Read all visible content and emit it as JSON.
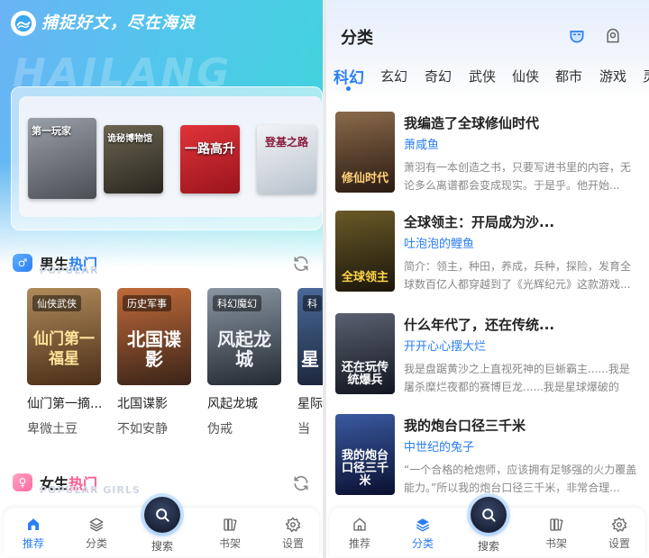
{
  "left": {
    "header": {
      "slogan": "捕捉好文，尽在海浪",
      "watermark": "HAILANG"
    },
    "banner": {
      "covers": [
        {
          "title": "第一玩家",
          "bg": "#5b5e63"
        },
        {
          "title": "诡秘博物馆",
          "bg": "#3d3a32"
        },
        {
          "title": "一路高升",
          "bg": "#c9202a"
        },
        {
          "title": "登基之路",
          "bg": "#d8dde4"
        }
      ]
    },
    "male_section": {
      "title_prefix": "男生",
      "title_highlight": "热门",
      "subtitle": "POPULAR",
      "books": [
        {
          "tag": "仙侠武侠",
          "cover_text": "仙门第一福星",
          "title": "仙门第一摘...",
          "author": "卑微土豆",
          "bg": "#6b4a2a",
          "fg": "#ffe39a"
        },
        {
          "tag": "历史军事",
          "cover_text": "北国谍影",
          "title": "北国谍影",
          "author": "不如安静",
          "bg": "#6a3e2a",
          "fg": "#ffffff"
        },
        {
          "tag": "科幻魔幻",
          "cover_text": "风起龙城",
          "title": "风起龙城",
          "author": "伪戒",
          "bg": "#3a4450",
          "fg": "#e6ecf2"
        },
        {
          "tag": "科",
          "cover_text": "星",
          "title": "星际...",
          "author": "当",
          "bg": "#2a3b58",
          "fg": "#ffffff"
        }
      ]
    },
    "female_section": {
      "title_prefix": "女生",
      "title_highlight": "热门",
      "subtitle": "POPULAR GIRLS"
    }
  },
  "right": {
    "title": "分类",
    "categories": [
      "科幻",
      "玄幻",
      "奇幻",
      "武侠",
      "仙侠",
      "都市",
      "游戏",
      "灵"
    ],
    "active_category": "科幻",
    "books": [
      {
        "name": "我编造了全球修仙时代",
        "author": "萧咸鱼",
        "desc": "萧羽有一本创造之书，只要写进书里的内容，无论多么离谱都会变成现实。于是乎。他开始...",
        "cover_text": "修仙时代",
        "bg": "#5a3a2a",
        "fg": "#ffd27a"
      },
      {
        "name": "全球领主：开局成为沙...",
        "author": "吐泡泡的鲤鱼",
        "desc": "简介：领主，种田，养成，兵种，探险，发育全球数百亿人都穿越到了《光辉纪元》这款游戏...",
        "cover_text": "全球领主",
        "bg": "#3a3318",
        "fg": "#ffd54a"
      },
      {
        "name": "什么年代了，还在传统...",
        "author": "开开心心摆大烂",
        "desc": "我是盘踞黄沙之上直视死神的巨蜥霸主......我是屠杀糜烂夜都的赛博巨龙......我是星球爆破的行...",
        "cover_text": "还在玩传统爆兵",
        "bg": "#2a2f3a",
        "fg": "#ffffff"
      },
      {
        "name": "我的炮台口径三千米",
        "author": "中世纪的兔子",
        "desc": "“一个合格的枪炮师，应该拥有足够强的火力覆盖能力。”所以我的炮台口径三千米，非常合理...",
        "cover_text": "我的炮台口径三千米",
        "bg": "#18234a",
        "fg": "#ffffff"
      }
    ]
  },
  "nav": {
    "items": [
      "推荐",
      "分类",
      "搜索",
      "书架",
      "设置"
    ],
    "left_active": "推荐",
    "right_active": "分类"
  },
  "colors": {
    "accent": "#2a7ef4",
    "hero_start": "#6ab3f5",
    "hero_end": "#3fd5d9"
  }
}
